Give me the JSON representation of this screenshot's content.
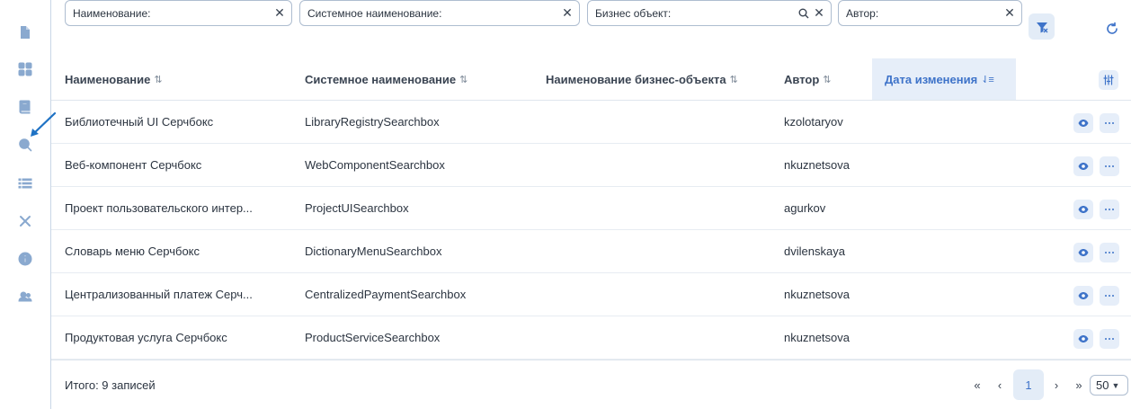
{
  "sidebar": {
    "icons": [
      "document-icon",
      "dashboard-icon",
      "book-icon",
      "search-icon",
      "list-icon",
      "tools-icon",
      "info-icon",
      "users-icon"
    ],
    "active": "search-icon",
    "accent": "#1f72c4"
  },
  "filters": {
    "name": "Наименование:",
    "system_name": "Системное наименование:",
    "business_object": "Бизнес объект:",
    "author": "Автор:"
  },
  "table": {
    "columns": [
      {
        "label": "Наименование",
        "sort": "⇅"
      },
      {
        "label": "Системное наименование",
        "sort": "⇅"
      },
      {
        "label": "Наименование бизнес-объекта",
        "sort": "⇅"
      },
      {
        "label": "Автор",
        "sort": "⇅"
      },
      {
        "label": "Дата изменения",
        "sort": "⇃≡",
        "active": true
      }
    ],
    "rows": [
      {
        "name": "Библиотечный UI Серчбокс",
        "system_name": "LibraryRegistrySearchbox",
        "business_object": "",
        "author": "kzolotaryov",
        "date": ""
      },
      {
        "name": "Веб-компонент Серчбокс",
        "system_name": "WebComponentSearchbox",
        "business_object": "",
        "author": "nkuznetsova",
        "date": ""
      },
      {
        "name": "Проект пользовательского интер...",
        "system_name": "ProjectUISearchbox",
        "business_object": "",
        "author": "agurkov",
        "date": ""
      },
      {
        "name": "Словарь меню Серчбокс",
        "system_name": "DictionaryMenuSearchbox",
        "business_object": "",
        "author": "dvilenskaya",
        "date": ""
      },
      {
        "name": "Централизованный платеж Серч...",
        "system_name": "CentralizedPaymentSearchbox",
        "business_object": "",
        "author": "nkuznetsova",
        "date": ""
      },
      {
        "name": "Продуктовая услуга Серчбокс",
        "system_name": "ProductServiceSearchbox",
        "business_object": "",
        "author": "nkuznetsova",
        "date": ""
      }
    ]
  },
  "footer": {
    "total": "Итого: 9 записей",
    "first": "«",
    "prev": "‹",
    "current_page": "1",
    "next": "›",
    "last": "»",
    "page_size": "50"
  },
  "colors": {
    "accent": "#3e73c9",
    "accent_bg": "#e6eef9",
    "border": "#aebdd0"
  }
}
